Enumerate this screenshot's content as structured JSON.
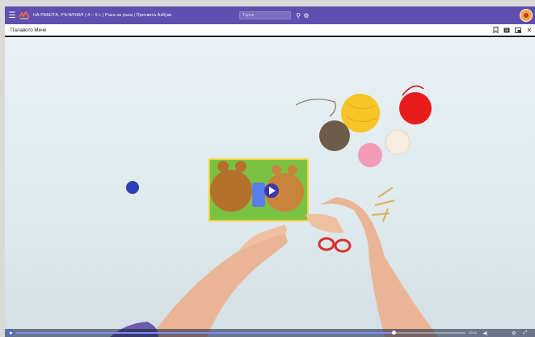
{
  "header": {
    "breadcrumb": "НА РАБОТА, РЪЧИЧКИ! | 4 – 5 г. | Ръка за ръка | Просвета Азбуки",
    "search_placeholder": "Търси"
  },
  "video": {
    "title": "Палавото Мече",
    "progress_fraction": 0.84,
    "time": "00:00"
  },
  "icons": {
    "menu": "menu-icon",
    "logo": "logo-icon",
    "search": "search-icon",
    "settings": "gear-icon",
    "avatar": "avatar",
    "bookmark": "bookmark-icon",
    "list": "list-icon",
    "window": "window-icon",
    "close": "close-icon",
    "play": "play-icon",
    "volume": "volume-icon",
    "fullscreen": "fullscreen-icon"
  },
  "colors": {
    "topbar": "#5f4fae",
    "accent": "#4a6bd8"
  }
}
